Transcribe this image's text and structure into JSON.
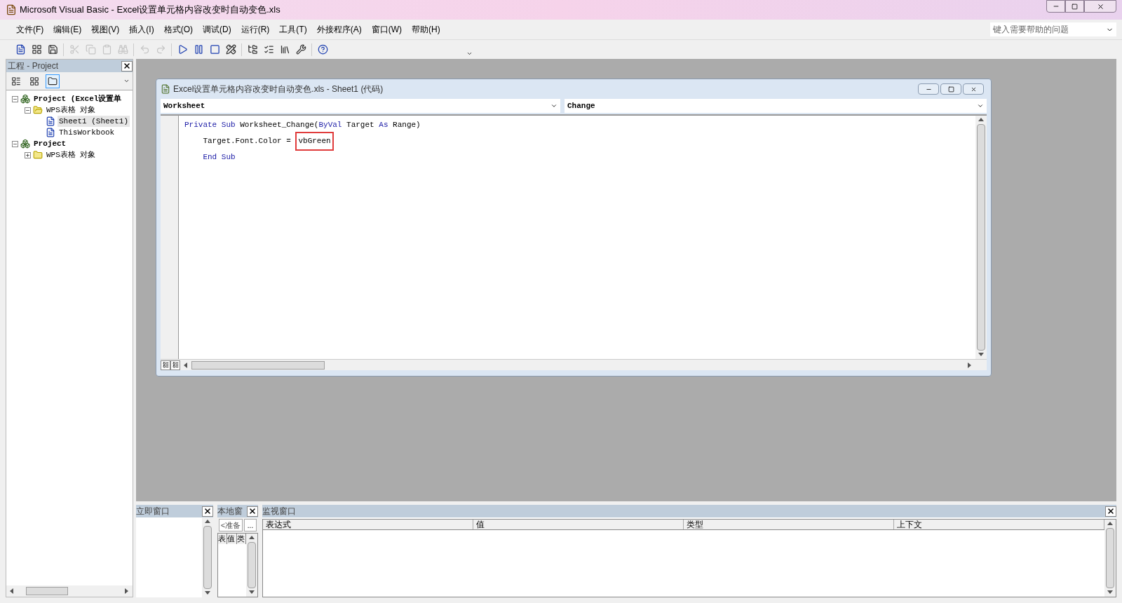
{
  "window": {
    "title": "Microsoft Visual Basic - Excel设置单元格内容改变时自动变色.xls"
  },
  "menu": [
    "文件(F)",
    "编辑(E)",
    "视图(V)",
    "插入(I)",
    "格式(O)",
    "调试(D)",
    "运行(R)",
    "工具(T)",
    "外接程序(A)",
    "窗口(W)",
    "帮助(H)"
  ],
  "help_search": {
    "placeholder": "键入需要帮助的问题"
  },
  "toolbar": [
    [
      {
        "kind": "view-app",
        "disabled": false
      },
      {
        "kind": "insert",
        "disabled": false
      },
      {
        "kind": "save",
        "disabled": false
      }
    ],
    [
      {
        "kind": "cut",
        "disabled": true
      },
      {
        "kind": "copy",
        "disabled": true
      },
      {
        "kind": "paste",
        "disabled": true
      },
      {
        "kind": "find",
        "disabled": true
      }
    ],
    [
      {
        "kind": "undo",
        "disabled": true
      },
      {
        "kind": "redo",
        "disabled": true
      }
    ],
    [
      {
        "kind": "run",
        "disabled": false
      },
      {
        "kind": "pause",
        "disabled": false
      },
      {
        "kind": "stop",
        "disabled": false
      },
      {
        "kind": "design",
        "disabled": false
      }
    ],
    [
      {
        "kind": "explorer",
        "disabled": false
      },
      {
        "kind": "properties",
        "disabled": false
      },
      {
        "kind": "browser",
        "disabled": false
      },
      {
        "kind": "toolbox",
        "disabled": false
      }
    ],
    [
      {
        "kind": "help",
        "disabled": false
      }
    ]
  ],
  "project_panel": {
    "title": "工程 - Project",
    "tools": [
      {
        "kind": "view-code",
        "selected": false
      },
      {
        "kind": "view-object",
        "selected": false
      },
      {
        "kind": "toggle-folders",
        "selected": true
      }
    ],
    "tree": [
      {
        "kind": "project",
        "label": "Project (Excel设置单",
        "expanded": true,
        "children": [
          {
            "kind": "folder",
            "label": "WPS表格 对象",
            "expanded": true,
            "children": [
              {
                "kind": "sheet",
                "label": "Sheet1 (Sheet1)",
                "selected": true
              },
              {
                "kind": "sheet",
                "label": "ThisWorkbook",
                "selected": false
              }
            ]
          }
        ]
      },
      {
        "kind": "project",
        "label": "Project",
        "expanded": true,
        "children": [
          {
            "kind": "folder",
            "label": "WPS表格 对象",
            "expanded": false
          }
        ]
      }
    ]
  },
  "code_window": {
    "title": "Excel设置单元格内容改变时自动变色.xls - Sheet1 (代码)",
    "object": "Worksheet",
    "procedure": "Change",
    "lines": [
      [
        {
          "kind": "keyword",
          "text": "Private Sub"
        },
        {
          "kind": "plain",
          "text": " Worksheet_Change("
        },
        {
          "kind": "keyword",
          "text": "ByVal"
        },
        {
          "kind": "plain",
          "text": " Target "
        },
        {
          "kind": "keyword",
          "text": "As"
        },
        {
          "kind": "plain",
          "text": " Range)"
        }
      ],
      [
        {
          "kind": "plain",
          "text": "    Target.Font.Color = "
        },
        {
          "kind": "highlight",
          "text": "vbGreen"
        }
      ],
      [
        {
          "kind": "keyword",
          "text": "    End Sub"
        }
      ]
    ]
  },
  "immediate": {
    "title": "立即窗口"
  },
  "locals": {
    "title": "本地窗",
    "context": "<准备",
    "more": "...",
    "columns": [
      "表",
      "值",
      "类"
    ]
  },
  "watch": {
    "title": "监视窗口",
    "columns": [
      "表达式",
      "值",
      "类型",
      "上下文"
    ]
  }
}
